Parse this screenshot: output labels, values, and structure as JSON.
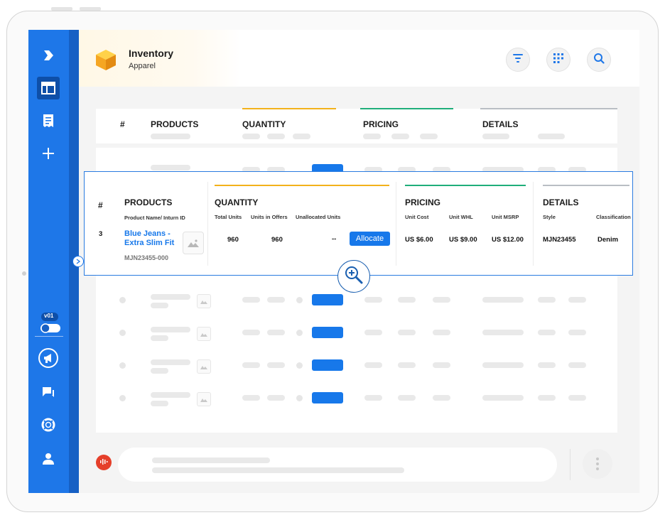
{
  "header": {
    "title": "Inventory",
    "subtitle": "Apparel",
    "logo_icon": "box-icon",
    "actions": [
      {
        "name": "filter-button",
        "icon": "filter-icon"
      },
      {
        "name": "grid-view-button",
        "icon": "grid-icon"
      },
      {
        "name": "search-button",
        "icon": "search-icon"
      }
    ]
  },
  "sidebar": {
    "items": [
      {
        "icon": "logo-icon"
      },
      {
        "icon": "layout-icon",
        "active": true
      },
      {
        "icon": "receipt-icon"
      },
      {
        "icon": "plus-icon"
      }
    ],
    "toggle_label": "v01",
    "bottom_items": [
      {
        "icon": "megaphone-icon"
      },
      {
        "icon": "chat-icon"
      },
      {
        "icon": "lifebuoy-icon"
      },
      {
        "icon": "user-icon"
      }
    ]
  },
  "table": {
    "headers": {
      "index": "#",
      "products": "PRODUCTS",
      "quantity": "QUANTITY",
      "pricing": "PRICING",
      "details": "DETAILS"
    }
  },
  "detail": {
    "headers": {
      "index": "#",
      "products": "PRODUCTS",
      "quantity": "QUANTITY",
      "pricing": "PRICING",
      "details": "DETAILS"
    },
    "subheaders": {
      "products": "Product Name/ Inturn  ID",
      "total_units": "Total Units",
      "units_in_offers": "Units in Offers",
      "unallocated_units": "Unallocated Units",
      "unit_cost": "Unit Cost",
      "unit_whl": "Unit WHL",
      "unit_msrp": "Unit MSRP",
      "style": "Style",
      "classification": "Classification"
    },
    "row": {
      "index": "3",
      "product_name_line1": "Blue Jeans -",
      "product_name_line2": "Extra Slim Fit",
      "product_id": "MJN23455-000",
      "total_units": "960",
      "units_in_offers": "960",
      "unallocated_units": "--",
      "allocate_label": "Allocate",
      "unit_cost": "US $6.00",
      "unit_whl": "US $9.00",
      "unit_msrp": "US $12.00",
      "style": "MJN23455",
      "classification": "Denim"
    },
    "accent_colors": {
      "quantity": "#f3b21b",
      "pricing": "#1fae7a",
      "details": "#b9bec4"
    }
  },
  "colors": {
    "primary": "#1e77e8",
    "primary_dark": "#1660c4",
    "mic": "#e53f2a"
  }
}
